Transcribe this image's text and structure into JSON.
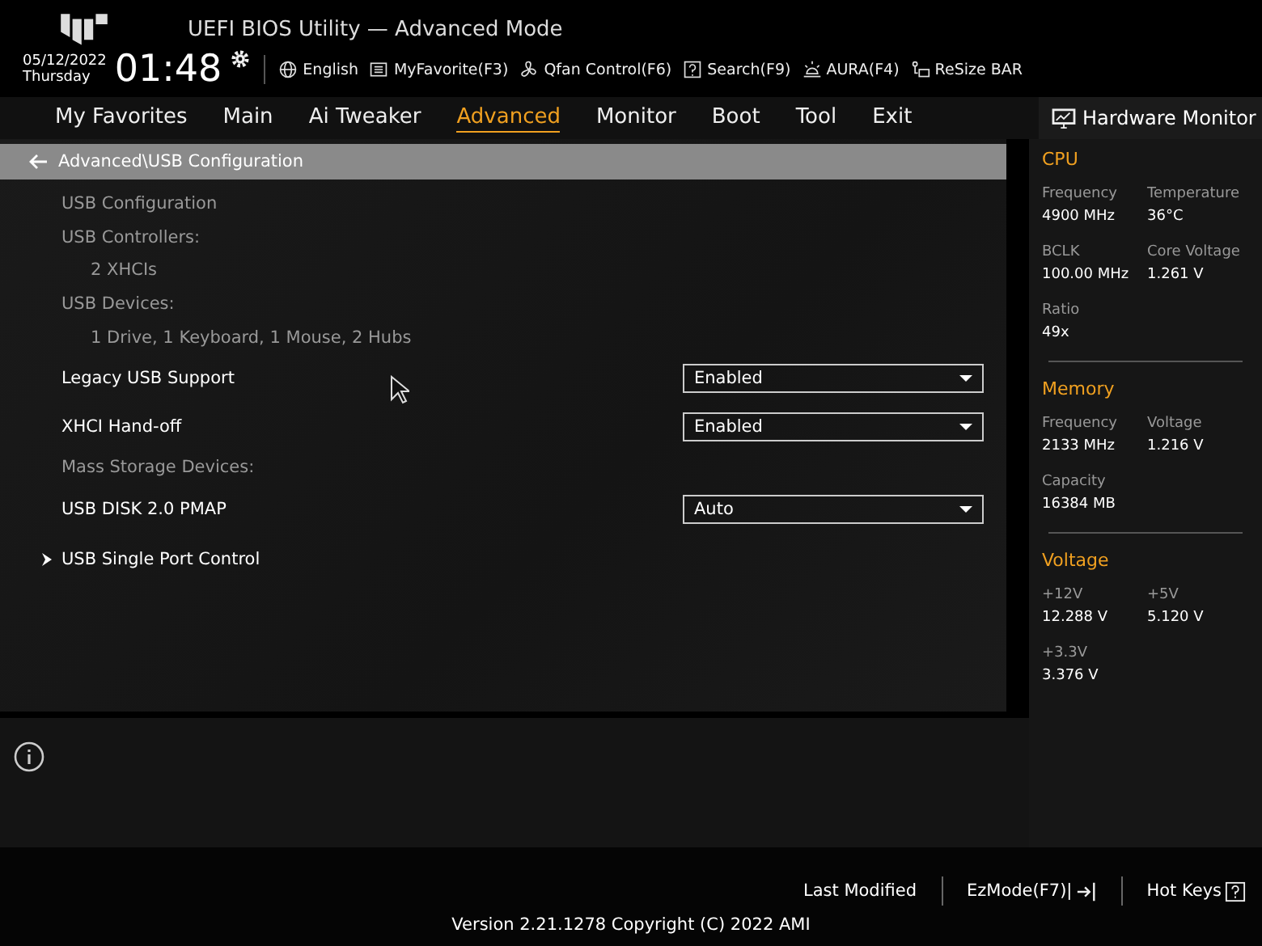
{
  "header": {
    "title": "UEFI BIOS Utility — Advanced Mode",
    "date": "05/12/2022",
    "day": "Thursday",
    "time": "01:48",
    "tools": [
      {
        "label": "English",
        "kind": "globe"
      },
      {
        "label": "MyFavorite(F3)",
        "kind": "list"
      },
      {
        "label": "Qfan Control(F6)",
        "kind": "fan"
      },
      {
        "label": "Search(F9)",
        "kind": "help"
      },
      {
        "label": "AURA(F4)",
        "kind": "light"
      },
      {
        "label": "ReSize BAR",
        "kind": "bar"
      }
    ]
  },
  "tabs": [
    {
      "label": "My Favorites",
      "selected": false
    },
    {
      "label": "Main",
      "selected": false
    },
    {
      "label": "Ai Tweaker",
      "selected": false
    },
    {
      "label": "Advanced",
      "selected": true
    },
    {
      "label": "Monitor",
      "selected": false
    },
    {
      "label": "Boot",
      "selected": false
    },
    {
      "label": "Tool",
      "selected": false
    },
    {
      "label": "Exit",
      "selected": false
    }
  ],
  "breadcrumb": "Advanced\\USB Configuration",
  "settings": [
    {
      "kind": "heading",
      "label": "USB Configuration"
    },
    {
      "kind": "heading",
      "label": "USB Controllers:"
    },
    {
      "kind": "info",
      "label": "2 XHCIs"
    },
    {
      "kind": "heading",
      "label": "USB Devices:"
    },
    {
      "kind": "info",
      "label": "1 Drive, 1 Keyboard, 1 Mouse, 2 Hubs"
    },
    {
      "kind": "option",
      "label": "Legacy USB Support",
      "value": "Enabled"
    },
    {
      "kind": "option",
      "label": "XHCI Hand-off",
      "value": "Enabled"
    },
    {
      "kind": "heading",
      "label": "Mass Storage Devices:"
    },
    {
      "kind": "option",
      "label": "USB DISK 2.0 PMAP",
      "value": "Auto"
    },
    {
      "kind": "submenu",
      "label": "USB Single Port Control"
    }
  ],
  "hardware_monitor": {
    "title": "Hardware Monitor",
    "sections": [
      {
        "title": "CPU",
        "items": [
          {
            "label": "Frequency",
            "value": "4900 MHz"
          },
          {
            "label": "Temperature",
            "value": "36°C"
          },
          {
            "label": "BCLK",
            "value": "100.00 MHz"
          },
          {
            "label": "Core Voltage",
            "value": "1.261 V"
          },
          {
            "label": "Ratio",
            "value": "49x"
          }
        ]
      },
      {
        "title": "Memory",
        "items": [
          {
            "label": "Frequency",
            "value": "2133 MHz"
          },
          {
            "label": "Voltage",
            "value": "1.216 V"
          },
          {
            "label": "Capacity",
            "value": "16384 MB"
          }
        ]
      },
      {
        "title": "Voltage",
        "items": [
          {
            "label": "+12V",
            "value": "12.288 V"
          },
          {
            "label": "+5V",
            "value": "5.120 V"
          },
          {
            "label": "+3.3V",
            "value": "3.376 V"
          }
        ]
      }
    ]
  },
  "footer": {
    "buttons": [
      {
        "label": "Last Modified",
        "kind": "plain"
      },
      {
        "label": "EzMode(F7)|",
        "kind": "exit"
      },
      {
        "label": "Hot Keys",
        "kind": "help"
      }
    ],
    "version": "Version 2.21.1278 Copyright (C) 2022 AMI"
  }
}
